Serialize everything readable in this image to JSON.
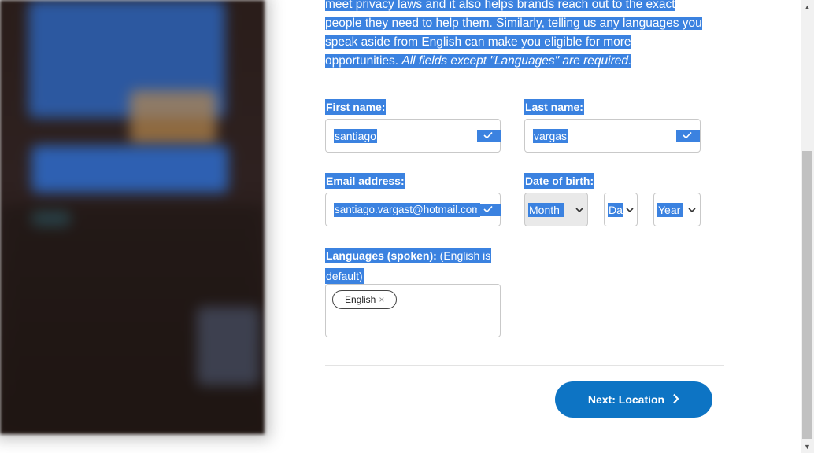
{
  "intro": {
    "line1": "meet privacy laws and it also helps brands reach out to the exact",
    "line2": "people they need to help them. Similarly, telling us any languages you",
    "line3": "speak aside from English can make you eligible for more",
    "line4_plain": "opportunities. ",
    "line4_em": "All fields except \"Languages\" are required."
  },
  "form": {
    "first_name_label": "First name:",
    "first_name_value": "santiago",
    "last_name_label": "Last name:",
    "last_name_value": "vargas",
    "email_label": "Email address:",
    "email_value": "santiago.vargast@hotmail.com",
    "dob_label": "Date of birth:",
    "dob_month": "Month",
    "dob_day": "Day",
    "dob_year": "Year",
    "languages_label_bold": "Languages (spoken):",
    "languages_label_rest_a": " (English is",
    "languages_label_rest_b": "default)",
    "languages": [
      "English"
    ],
    "chip_remove": "×"
  },
  "next_button": {
    "label": "Next: Location"
  },
  "colors": {
    "accent": "#0d74c4",
    "selection": "#3b82e0"
  },
  "icons": {
    "check": "check-icon",
    "chevron": "chevron-down-icon",
    "arrow": "chevron-right-icon"
  }
}
